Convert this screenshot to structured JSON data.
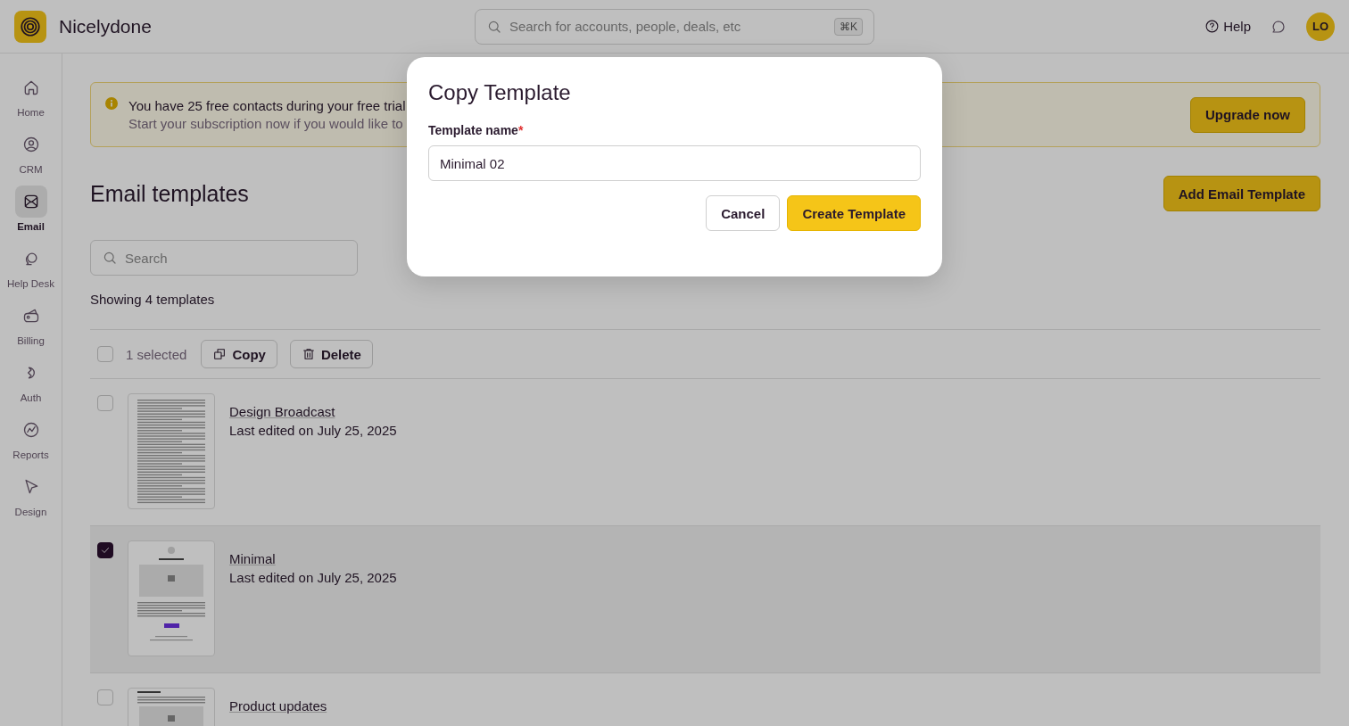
{
  "app": {
    "name": "Nicelydone"
  },
  "search": {
    "placeholder": "Search for accounts, people, deals, etc",
    "shortcut": "⌘K"
  },
  "header_actions": {
    "help": "Help",
    "avatar": "LO"
  },
  "sidebar": {
    "items": [
      {
        "label": "Home",
        "selected": false
      },
      {
        "label": "CRM",
        "selected": false
      },
      {
        "label": "Email",
        "selected": true
      },
      {
        "label": "Help Desk",
        "selected": false
      },
      {
        "label": "Billing",
        "selected": false
      },
      {
        "label": "Auth",
        "selected": false
      },
      {
        "label": "Reports",
        "selected": false
      },
      {
        "label": "Design",
        "selected": false
      }
    ]
  },
  "banner": {
    "title": "You have 25 free contacts during your free trial",
    "text": "Start your subscription now if you would like to",
    "button": "Upgrade now"
  },
  "page": {
    "title": "Email templates",
    "add_button": "Add Email Template",
    "search_placeholder": "Search",
    "count": "Showing 4 templates"
  },
  "toolbar": {
    "checked": false,
    "selection": "1 selected",
    "actions": [
      "Copy",
      "Delete"
    ]
  },
  "templates": [
    {
      "name": "Design Broadcast",
      "edited": "Last edited on July 25, 2025",
      "selected": false,
      "kind": "text"
    },
    {
      "name": "Minimal",
      "edited": "Last edited on July 25, 2025",
      "selected": true,
      "kind": "minimal"
    },
    {
      "name": "Product updates",
      "selected": false,
      "kind": "updates"
    }
  ],
  "dialog": {
    "title": "Copy Template",
    "field_label": "Template name",
    "required_mark": "*",
    "value": "Minimal 02",
    "buttons": [
      {
        "label": "Cancel",
        "kind": "secondary"
      },
      {
        "label": "Create Template",
        "kind": "primary"
      }
    ]
  }
}
